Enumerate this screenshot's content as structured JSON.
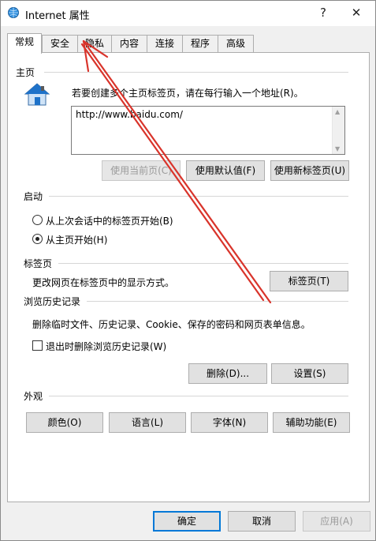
{
  "window": {
    "title": "Internet 属性",
    "help": "?",
    "close": "✕"
  },
  "tabs": [
    {
      "label": "常规",
      "active": true
    },
    {
      "label": "安全"
    },
    {
      "label": "隐私"
    },
    {
      "label": "内容"
    },
    {
      "label": "连接"
    },
    {
      "label": "程序"
    },
    {
      "label": "高级"
    }
  ],
  "home": {
    "section": "主页",
    "instruction": "若要创建多个主页标签页，请在每行输入一个地址(R)。",
    "url": "http://www.baidu.com/",
    "use_current": "使用当前页(C)",
    "use_default": "使用默认值(F)",
    "use_new_tab": "使用新标签页(U)"
  },
  "startup": {
    "section": "启动",
    "option_last_session": "从上次会话中的标签页开始(B)",
    "option_home": "从主页开始(H)",
    "selected": "option_home"
  },
  "tabs_section": {
    "section": "标签页",
    "description": "更改网页在标签页中的显示方式。",
    "button": "标签页(T)"
  },
  "history": {
    "section": "浏览历史记录",
    "description": "删除临时文件、历史记录、Cookie、保存的密码和网页表单信息。",
    "checkbox": "退出时删除浏览历史记录(W)",
    "delete": "删除(D)...",
    "settings": "设置(S)"
  },
  "appearance": {
    "section": "外观",
    "colors": "颜色(O)",
    "languages": "语言(L)",
    "fonts": "字体(N)",
    "accessibility": "辅助功能(E)"
  },
  "footer": {
    "ok": "确定",
    "cancel": "取消",
    "apply": "应用(A)"
  },
  "colors": {
    "arrow": "#d9342b",
    "accent": "#0078d7",
    "icon_blue": "#1e72c9"
  }
}
